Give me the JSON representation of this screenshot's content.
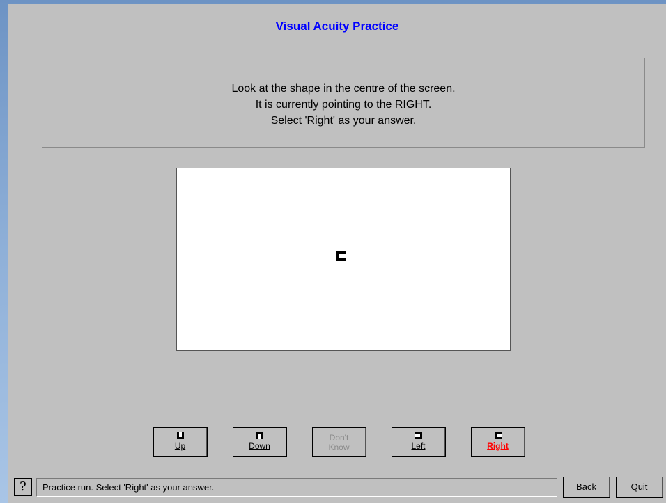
{
  "title": "Visual Acuity Practice",
  "instructions": [
    "Look at the shape in the centre of the screen.",
    "It is currently pointing to the RIGHT.",
    "Select 'Right' as your answer."
  ],
  "stimulus": {
    "shape": "landolt-square",
    "direction": "right"
  },
  "buttons": {
    "up": "Up",
    "down": "Down",
    "dont_know_line1": "Don't",
    "dont_know_line2": "Know",
    "left": "Left",
    "right": "Right"
  },
  "status": {
    "help_glyph": "?",
    "message": "Practice run. Select 'Right' as your answer.",
    "back": "Back",
    "quit": "Quit"
  },
  "colors": {
    "title": "#0000ff",
    "selected": "#ff0000",
    "panel": "#c0c0c0"
  }
}
